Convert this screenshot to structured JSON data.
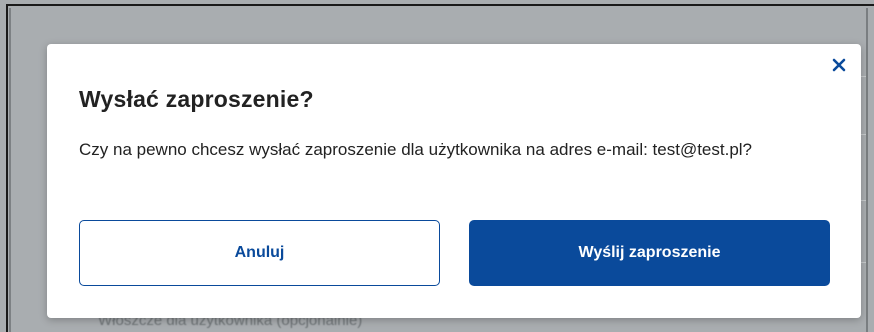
{
  "background": {
    "partial_text": "Włoszcze dla użytkownika (opcjonalnie)"
  },
  "dialog": {
    "title": "Wysłać zaproszenie?",
    "message": "Czy na pewno chcesz wysłać zaproszenie dla użytkownika na adres e-mail: test@test.pl?",
    "close_icon": "close-icon",
    "cancel_label": "Anuluj",
    "confirm_label": "Wyślij zaproszenie"
  },
  "colors": {
    "primary": "#0a4a9b",
    "overlay": "#a9adb0",
    "text": "#222222"
  }
}
